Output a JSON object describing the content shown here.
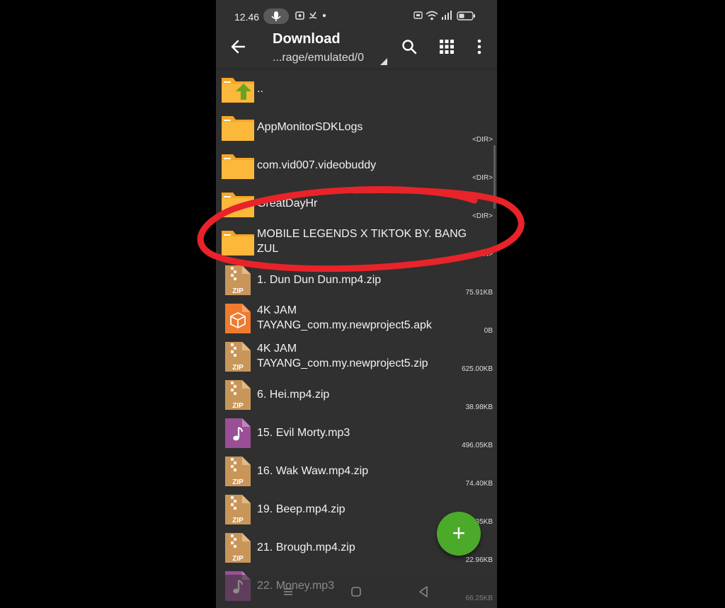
{
  "status_bar": {
    "time": "12.46",
    "notification_icons": [
      "mic-icon",
      "screen-record-icon",
      "missed-call-icon",
      "dot-icon"
    ],
    "system_icons": [
      "nfc-icon",
      "wifi-icon",
      "signal-icon",
      "battery-icon"
    ]
  },
  "app_bar": {
    "title": "Download",
    "path": "...rage/emulated/0",
    "actions": [
      "search-icon",
      "grid-view-icon",
      "more-vert-icon"
    ]
  },
  "files": [
    {
      "name": "..",
      "meta": "",
      "type": "parent-folder"
    },
    {
      "name": "AppMonitorSDKLogs",
      "meta": "<DIR>",
      "type": "folder"
    },
    {
      "name": "com.vid007.videobuddy",
      "meta": "<DIR>",
      "type": "folder"
    },
    {
      "name": "GreatDayHr",
      "meta": "<DIR>",
      "type": "folder"
    },
    {
      "name": "MOBILE LEGENDS X TIKTOK BY. BANG ZUL",
      "meta": "<DIR>",
      "type": "folder"
    },
    {
      "name": "1. Dun Dun Dun.mp4.zip",
      "meta": "75.91KB",
      "type": "zip"
    },
    {
      "name": "4K JAM TAYANG_com.my.newproject5.apk",
      "meta": "0B",
      "type": "apk"
    },
    {
      "name": "4K JAM TAYANG_com.my.newproject5.zip",
      "meta": "625.00KB",
      "type": "zip"
    },
    {
      "name": "6. Hei.mp4.zip",
      "meta": "38.98KB",
      "type": "zip"
    },
    {
      "name": "15. Evil Morty.mp3",
      "meta": "496.05KB",
      "type": "audio"
    },
    {
      "name": "16. Wak Waw.mp4.zip",
      "meta": "74.40KB",
      "type": "zip"
    },
    {
      "name": "19. Beep.mp4.zip",
      "meta": "6.35KB",
      "type": "zip"
    },
    {
      "name": "21. Brough.mp4.zip",
      "meta": "22.96KB",
      "type": "zip"
    },
    {
      "name": "22. Money.mp3",
      "meta": "66.25KB",
      "type": "audio"
    }
  ],
  "zip_label": "ZIP",
  "fab": {
    "label": "+",
    "color": "#4caa2a"
  },
  "annotation": {
    "color": "#e8232a",
    "highlighted": "MOBILE LEGENDS X TIKTOK BY. BANG ZUL"
  },
  "colors": {
    "folder": "#f5a623",
    "apk": "#f07a2d",
    "audio": "#9b4f96",
    "zip": "#c9965a"
  }
}
